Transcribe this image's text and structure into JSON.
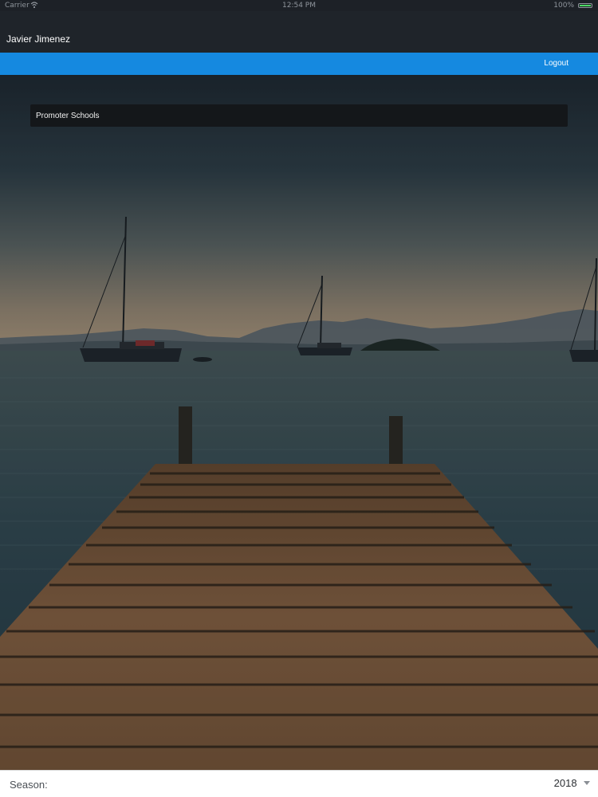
{
  "status_bar": {
    "carrier": "Carrier",
    "time": "12:54 PM",
    "battery": "100%"
  },
  "header": {
    "user_name": "Javier Jimenez"
  },
  "nav": {
    "logout_label": "Logout"
  },
  "menu": {
    "items": [
      {
        "label": "Promoter Schools"
      }
    ]
  },
  "footer": {
    "season_label": "Season:",
    "season_value": "2018"
  },
  "colors": {
    "nav_accent": "#1589e0",
    "header_bg": "#1f242a",
    "battery_green": "#4cd964"
  },
  "background_image": {
    "subject": "wooden pier over calm sea with sailboats at dusk"
  }
}
